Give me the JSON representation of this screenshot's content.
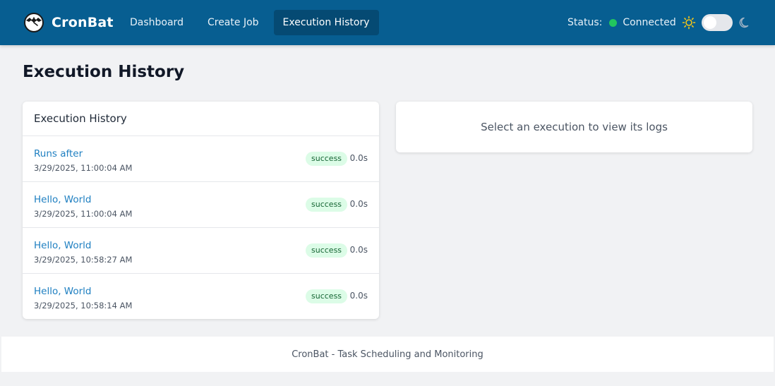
{
  "app": {
    "name": "CronBat"
  },
  "nav": {
    "items": [
      {
        "label": "Dashboard",
        "active": false
      },
      {
        "label": "Create Job",
        "active": false
      },
      {
        "label": "Execution History",
        "active": true
      }
    ]
  },
  "status": {
    "label": "Status:",
    "value": "Connected",
    "color": "#22c55e"
  },
  "theme": {
    "icons": [
      "sun-icon",
      "moon-icon"
    ],
    "dark_mode": false
  },
  "page": {
    "title": "Execution History"
  },
  "history": {
    "header": "Execution History",
    "rows": [
      {
        "name": "Runs after",
        "time": "3/29/2025, 11:00:04 AM",
        "status": "success",
        "duration": "0.0s"
      },
      {
        "name": "Hello, World",
        "time": "3/29/2025, 11:00:04 AM",
        "status": "success",
        "duration": "0.0s"
      },
      {
        "name": "Hello, World",
        "time": "3/29/2025, 10:58:27 AM",
        "status": "success",
        "duration": "0.0s"
      },
      {
        "name": "Hello, World",
        "time": "3/29/2025, 10:58:14 AM",
        "status": "success",
        "duration": "0.0s"
      }
    ]
  },
  "logs": {
    "placeholder": "Select an execution to view its logs"
  },
  "footer": {
    "text": "CronBat - Task Scheduling and Monitoring"
  },
  "colors": {
    "header_bg": "#075e91",
    "link": "#1e7fc1",
    "success_bg": "#dcfce7",
    "success_text": "#166534"
  }
}
